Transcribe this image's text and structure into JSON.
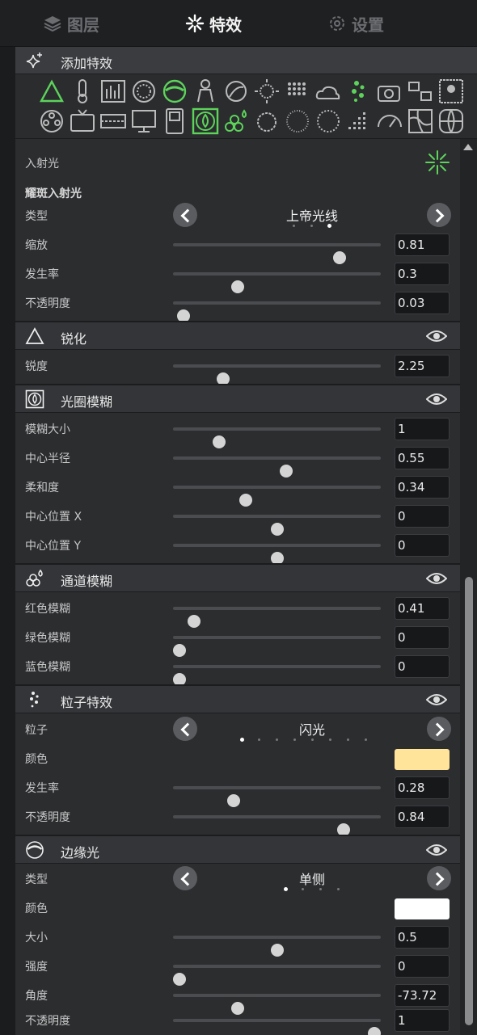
{
  "tabs": [
    {
      "label": "图层",
      "icon": "layers-icon"
    },
    {
      "label": "特效",
      "icon": "sparkle-icon"
    },
    {
      "label": "设置",
      "icon": "gear-icon"
    }
  ],
  "add_effects": {
    "label": "添加特效",
    "icon": "sparkles-add-icon"
  },
  "colors": {
    "accent_green": "#5dd35b",
    "panel": "#2b2d2f",
    "header": "#333538"
  },
  "incident_light": {
    "label": "入射光",
    "icon": "starburst-icon"
  },
  "flare": {
    "title": "耀斑入射光",
    "type": {
      "label": "类型",
      "value": "上帝光线",
      "dot_count": 3,
      "active_dot": 2
    },
    "scale": {
      "label": "缩放",
      "value": "0.81",
      "level": 0.8
    },
    "rate": {
      "label": "发生率",
      "value": "0.3",
      "level": 0.31
    },
    "opacity": {
      "label": "不透明度",
      "value": "0.03",
      "level": 0.05
    }
  },
  "sharpen": {
    "title": "锐化",
    "icon": "triangle-icon",
    "amount": {
      "label": "锐度",
      "value": "2.25",
      "level": 0.24
    }
  },
  "aperture": {
    "title": "光圈模糊",
    "icon": "aperture-icon",
    "size": {
      "label": "模糊大小",
      "value": "1",
      "level": 0.22
    },
    "radius": {
      "label": "中心半径",
      "value": "0.55",
      "level": 0.545
    },
    "softness": {
      "label": "柔和度",
      "value": "0.34",
      "level": 0.35
    },
    "cx": {
      "label": "中心位置 X",
      "value": "0",
      "level": 0.5
    },
    "cy": {
      "label": "中心位置 Y",
      "value": "0",
      "level": 0.5
    }
  },
  "channel": {
    "title": "通道模糊",
    "icon": "channel-blur-icon",
    "red": {
      "label": "红色模糊",
      "value": "0.41",
      "level": 0.1
    },
    "green": {
      "label": "绿色模糊",
      "value": "0",
      "level": 0.03
    },
    "blue": {
      "label": "蓝色模糊",
      "value": "0",
      "level": 0.03
    }
  },
  "particles": {
    "title": "粒子特效",
    "icon": "particles-icon",
    "type": {
      "label": "粒子",
      "value": "闪光",
      "dot_count": 8,
      "active_dot": 0
    },
    "color": {
      "label": "颜色",
      "value": "#ffe49a"
    },
    "rate": {
      "label": "发生率",
      "value": "0.28",
      "level": 0.29
    },
    "opacity": {
      "label": "不透明度",
      "value": "0.84",
      "level": 0.82
    }
  },
  "edge": {
    "title": "边缘光",
    "icon": "edge-light-icon",
    "type": {
      "label": "类型",
      "value": "单侧",
      "dot_count": 4,
      "active_dot": 0
    },
    "color": {
      "label": "颜色",
      "value": "#ffffff"
    },
    "size": {
      "label": "大小",
      "value": "0.5",
      "level": 0.5
    },
    "strength": {
      "label": "强度",
      "value": "0",
      "level": 0.03
    },
    "angle": {
      "label": "角度",
      "value": "-73.72",
      "level": 0.31
    },
    "opacity": {
      "label": "不透明度",
      "value": "1",
      "level": 0.97
    }
  }
}
